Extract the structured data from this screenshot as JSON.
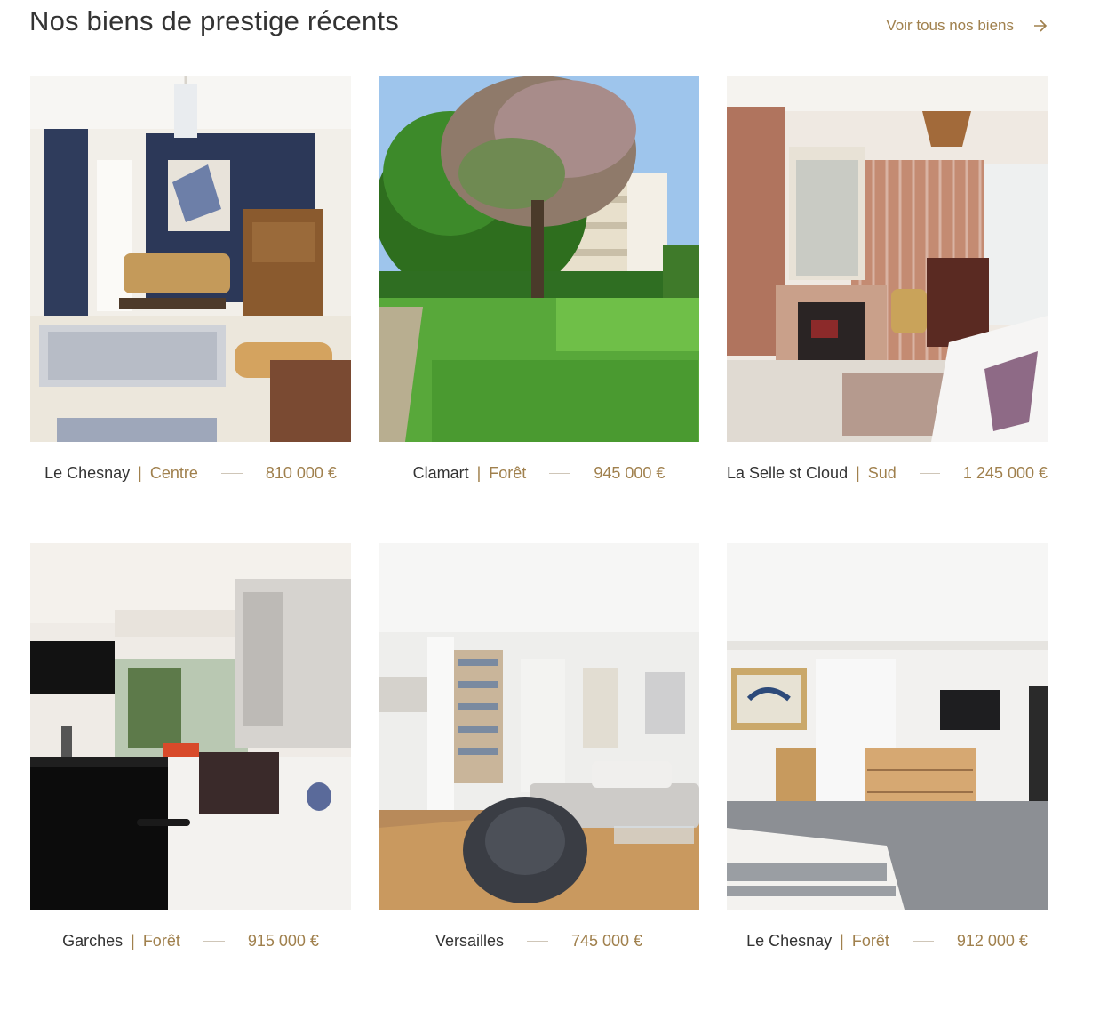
{
  "header": {
    "title": "Nos biens de prestige récents",
    "see_all_label": "Voir tous nos biens",
    "see_all_icon": "arrow-right-icon"
  },
  "colors": {
    "accent": "#a0804d",
    "text": "#333333"
  },
  "listings": [
    {
      "city": "Le Chesnay",
      "district": "Centre",
      "price": "810 000 €",
      "image": "living-room-photo"
    },
    {
      "city": "Clamart",
      "district": "Forêt",
      "price": "945 000 €",
      "image": "garden-photo"
    },
    {
      "city": "La Selle st Cloud",
      "district": "Sud",
      "price": "1 245 000 €",
      "image": "bedroom-photo"
    },
    {
      "city": "Garches",
      "district": "Forêt",
      "price": "915 000 €",
      "image": "kitchen-photo"
    },
    {
      "city": "Versailles",
      "district": "",
      "price": "745 000 €",
      "image": "salon-photo"
    },
    {
      "city": "Le Chesnay",
      "district": "Forêt",
      "price": "912 000 €",
      "image": "bedroom-loft-photo"
    }
  ]
}
